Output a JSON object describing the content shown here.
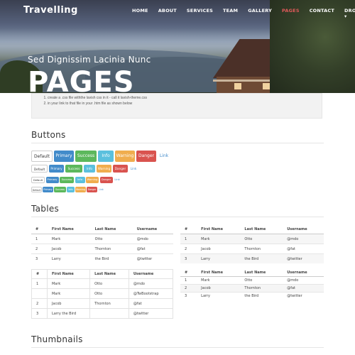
{
  "header": {
    "brand": "Travelling",
    "nav": [
      "HOME",
      "ABOUT",
      "SERVICES",
      "TEAM",
      "GALLERY",
      "PAGES",
      "CONTACT",
      "DROPDOWN ▾"
    ],
    "active_index": 5
  },
  "hero": {
    "subtitle": "Sed Dignissim Lacinia Nunc",
    "title": "PAGES"
  },
  "note": {
    "lines": [
      "create a .css file withthe lavish css in it - call it lavish-theme.css",
      "in your link to that file in your .htm file as shown below"
    ]
  },
  "sections": {
    "buttons": "Buttons",
    "tables": "Tables",
    "thumbnails": "Thumbnails"
  },
  "buttons": {
    "labels": [
      "Default",
      "Primary",
      "Success",
      "Info",
      "Warning",
      "Danger",
      "Link"
    ],
    "styles": [
      "default",
      "primary",
      "success",
      "info",
      "warning",
      "danger",
      "link"
    ]
  },
  "tables": {
    "headers": [
      "#",
      "First Name",
      "Last Name",
      "Username"
    ],
    "basic_rows": [
      [
        "1",
        "Mark",
        "Otto",
        "@mdo"
      ],
      [
        "2",
        "Jacob",
        "Thornton",
        "@fat"
      ],
      [
        "3",
        "Larry",
        "the Bird",
        "@twitter"
      ]
    ],
    "bordered_rows": [
      [
        "1",
        "Mark",
        "Otto",
        "@mdo"
      ],
      [
        "",
        "Mark",
        "Otto",
        "@TwBootstrap"
      ],
      [
        "2",
        "Jacob",
        "Thornton",
        "@fat"
      ],
      [
        "3",
        "Larry the Bird",
        "",
        "@twitter"
      ]
    ]
  },
  "colors": {
    "primary": "#428bca",
    "success": "#5cb85c",
    "info": "#5bc0de",
    "warning": "#f0ad4e",
    "danger": "#d9534f",
    "nav_active": "#e05a5a"
  }
}
